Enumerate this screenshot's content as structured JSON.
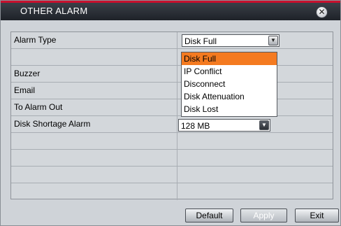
{
  "window": {
    "title": "OTHER ALARM",
    "close_glyph": "✕"
  },
  "settings": {
    "rows": [
      {
        "label": "Alarm Type",
        "value": "Disk Full",
        "control": "dropdown-open"
      },
      {
        "label": "",
        "value": ""
      },
      {
        "label": "Buzzer",
        "value": ""
      },
      {
        "label": "Email",
        "value": ""
      },
      {
        "label": "To Alarm Out",
        "value": ""
      },
      {
        "label": "Disk Shortage Alarm",
        "value": "128 MB",
        "control": "dropdown"
      },
      {
        "label": "",
        "value": ""
      },
      {
        "label": "",
        "value": ""
      },
      {
        "label": "",
        "value": ""
      },
      {
        "label": "",
        "value": ""
      }
    ]
  },
  "alarm_type_dropdown": {
    "arrow_glyph": "▼",
    "options": [
      "Disk Full",
      "IP Conflict",
      "Disconnect",
      "Disk Attenuation",
      "Disk Lost"
    ],
    "selected_index": 0
  },
  "disk_shortage_arrow_glyph": "▼",
  "buttons": {
    "default_label": "Default",
    "apply_label": "Apply",
    "exit_label": "Exit"
  },
  "colors": {
    "title_accent": "#c8102e",
    "selected_option": "#f47a20"
  }
}
